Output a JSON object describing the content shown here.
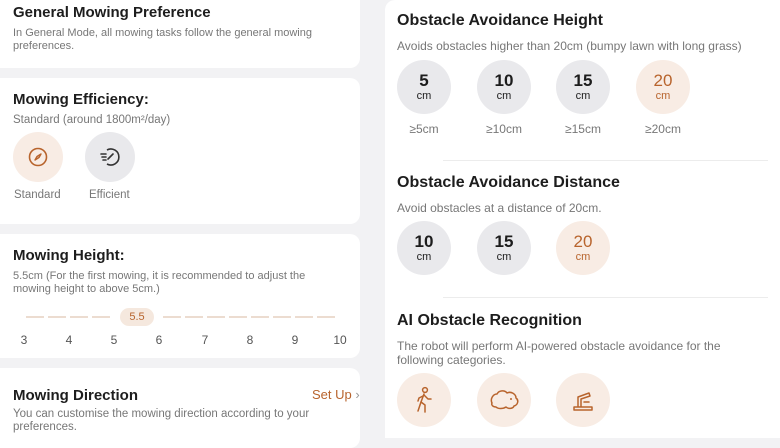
{
  "general": {
    "title": "General Mowing Preference",
    "desc": "In General Mode, all mowing tasks follow the general mowing preferences."
  },
  "efficiency": {
    "title": "Mowing Efficiency:",
    "desc": "Standard (around 1800m²/day)",
    "options": [
      {
        "label": "Standard",
        "icon": "compass-icon"
      },
      {
        "label": "Efficient",
        "icon": "speed-icon"
      }
    ]
  },
  "height": {
    "title": "Mowing Height:",
    "desc": "5.5cm (For the first mowing, it is recommended to adjust the mowing height to above 5cm.)",
    "current": "5.5",
    "ticks": [
      "3",
      "4",
      "5",
      "6",
      "7",
      "8",
      "9",
      "10"
    ]
  },
  "direction": {
    "title": "Mowing Direction",
    "action": "Set Up",
    "desc": "You can customise the mowing direction according to your preferences."
  },
  "avoid_height": {
    "title": "Obstacle Avoidance Height",
    "desc": "Avoids obstacles higher than 20cm (bumpy lawn with long grass)",
    "options": [
      {
        "num": "5",
        "unit": "cm",
        "below": "≥5cm"
      },
      {
        "num": "10",
        "unit": "cm",
        "below": "≥10cm"
      },
      {
        "num": "15",
        "unit": "cm",
        "below": "≥15cm"
      },
      {
        "num": "20",
        "unit": "cm",
        "below": "≥20cm"
      }
    ],
    "selected": "20"
  },
  "avoid_distance": {
    "title": "Obstacle Avoidance Distance",
    "desc": "Avoid obstacles at a distance of 20cm.",
    "options": [
      {
        "num": "10",
        "unit": "cm"
      },
      {
        "num": "15",
        "unit": "cm"
      },
      {
        "num": "20",
        "unit": "cm"
      }
    ],
    "selected": "20"
  },
  "ai": {
    "title": "AI Obstacle Recognition",
    "desc": "The robot will perform AI-powered obstacle avoidance for the following categories.",
    "categories": [
      {
        "icon": "person-walking-icon"
      },
      {
        "icon": "animal-icon"
      },
      {
        "icon": "object-icon"
      }
    ]
  },
  "colors": {
    "accent": "#b8642d",
    "selected_bg": "#f8ece4",
    "unselected_bg": "#e9e9ec"
  }
}
